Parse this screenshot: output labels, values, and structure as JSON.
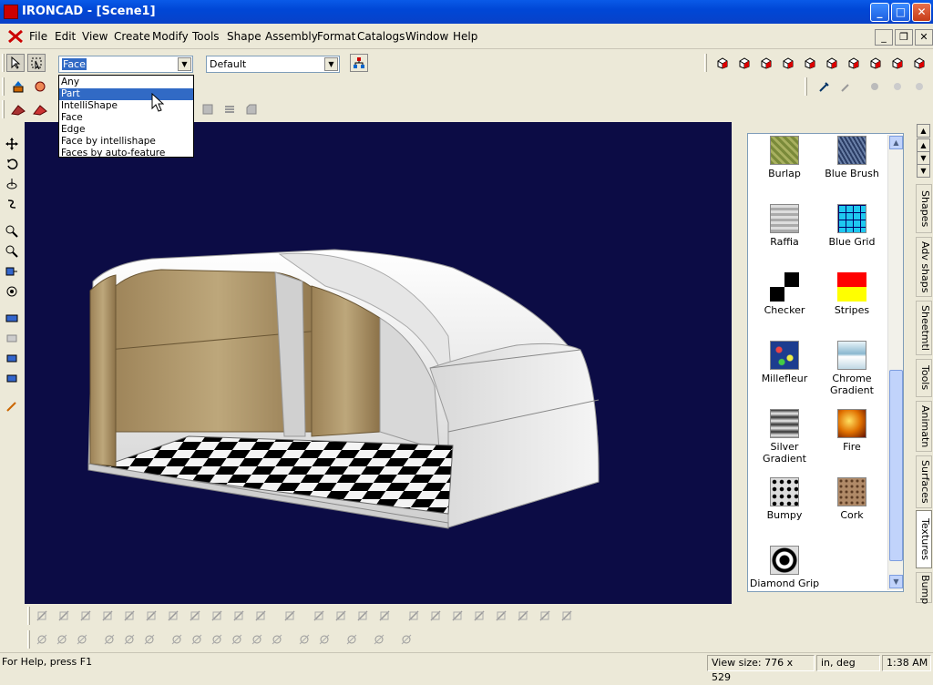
{
  "window": {
    "title": "IRONCAD - [Scene1]",
    "minimize": "_",
    "maximize": "□",
    "close": "✕"
  },
  "menu": {
    "items": [
      "File",
      "Edit",
      "View",
      "Create",
      "Modify",
      "Tools",
      "Shape",
      "Assembly",
      "Format",
      "Catalogs",
      "Window",
      "Help"
    ]
  },
  "toolbar": {
    "filter_value": "Face",
    "filter_options": [
      "Any",
      "Part",
      "IntelliShape",
      "Face",
      "Edge",
      "Face by intellishape",
      "Faces by auto-feature"
    ],
    "filter_highlighted": "Part",
    "style_value": "Default"
  },
  "catalog": {
    "textures": [
      {
        "name": "Burlap",
        "swatch": "burlap"
      },
      {
        "name": "Blue Brush",
        "swatch": "bluebrush"
      },
      {
        "name": "Raffia",
        "swatch": "raffia"
      },
      {
        "name": "Blue Grid",
        "swatch": "bluegrid"
      },
      {
        "name": "Checker",
        "swatch": "checker"
      },
      {
        "name": "Stripes",
        "swatch": "stripes"
      },
      {
        "name": "Millefleur",
        "swatch": "millefleur"
      },
      {
        "name": "Chrome Gradient",
        "swatch": "chrome"
      },
      {
        "name": "Silver Gradient",
        "swatch": "silver"
      },
      {
        "name": "Fire",
        "swatch": "fire"
      },
      {
        "name": "Bumpy",
        "swatch": "bumpy"
      },
      {
        "name": "Cork",
        "swatch": "cork"
      },
      {
        "name": "Diamond Grip",
        "swatch": "diamond"
      }
    ],
    "tabs": [
      "Shapes",
      "Adv shaps",
      "Sheetmtl",
      "Tools",
      "Animatn",
      "Surfaces",
      "Textures",
      "Bump"
    ],
    "active_tab": "Textures"
  },
  "status": {
    "help": "For Help, press F1",
    "view_size_label": "View size:",
    "view_size": "776 x  529",
    "units": "in, deg",
    "time": "1:38 AM"
  },
  "colors": {
    "viewport_bg": "#0c0c45",
    "titlebar": "#0047d6",
    "selection": "#316ac5"
  }
}
